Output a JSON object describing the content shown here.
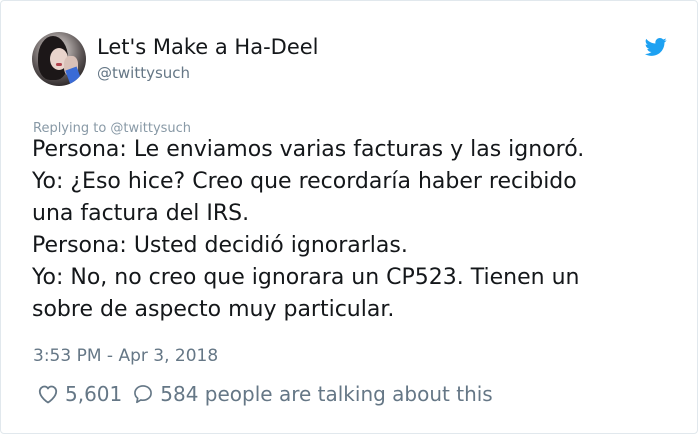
{
  "author": {
    "display_name": "Let's Make a Ha-Deel",
    "handle": "@twittysuch"
  },
  "icons": {
    "brand": "twitter-bird-icon",
    "like": "heart-icon",
    "reply": "speech-bubble-icon"
  },
  "colors": {
    "twitter_blue": "#1da1f2",
    "text": "#14171a",
    "muted": "#657786"
  },
  "tweet": {
    "replying_to": "Replying to @twittysuch",
    "lines": [
      "Persona: Le enviamos varias facturas y las ignoró.",
      "Yo: ¿Eso hice? Creo que recordaría haber recibido",
      "una factura del IRS.",
      "Persona: Usted decidió ignorarlas.",
      "Yo: No, no creo que ignorara un CP523. Tienen un",
      "sobre de aspecto muy particular."
    ],
    "timestamp": "3:53 PM - Apr 3, 2018"
  },
  "engagement": {
    "likes": "5,601",
    "talking": "584 people are talking about this"
  }
}
